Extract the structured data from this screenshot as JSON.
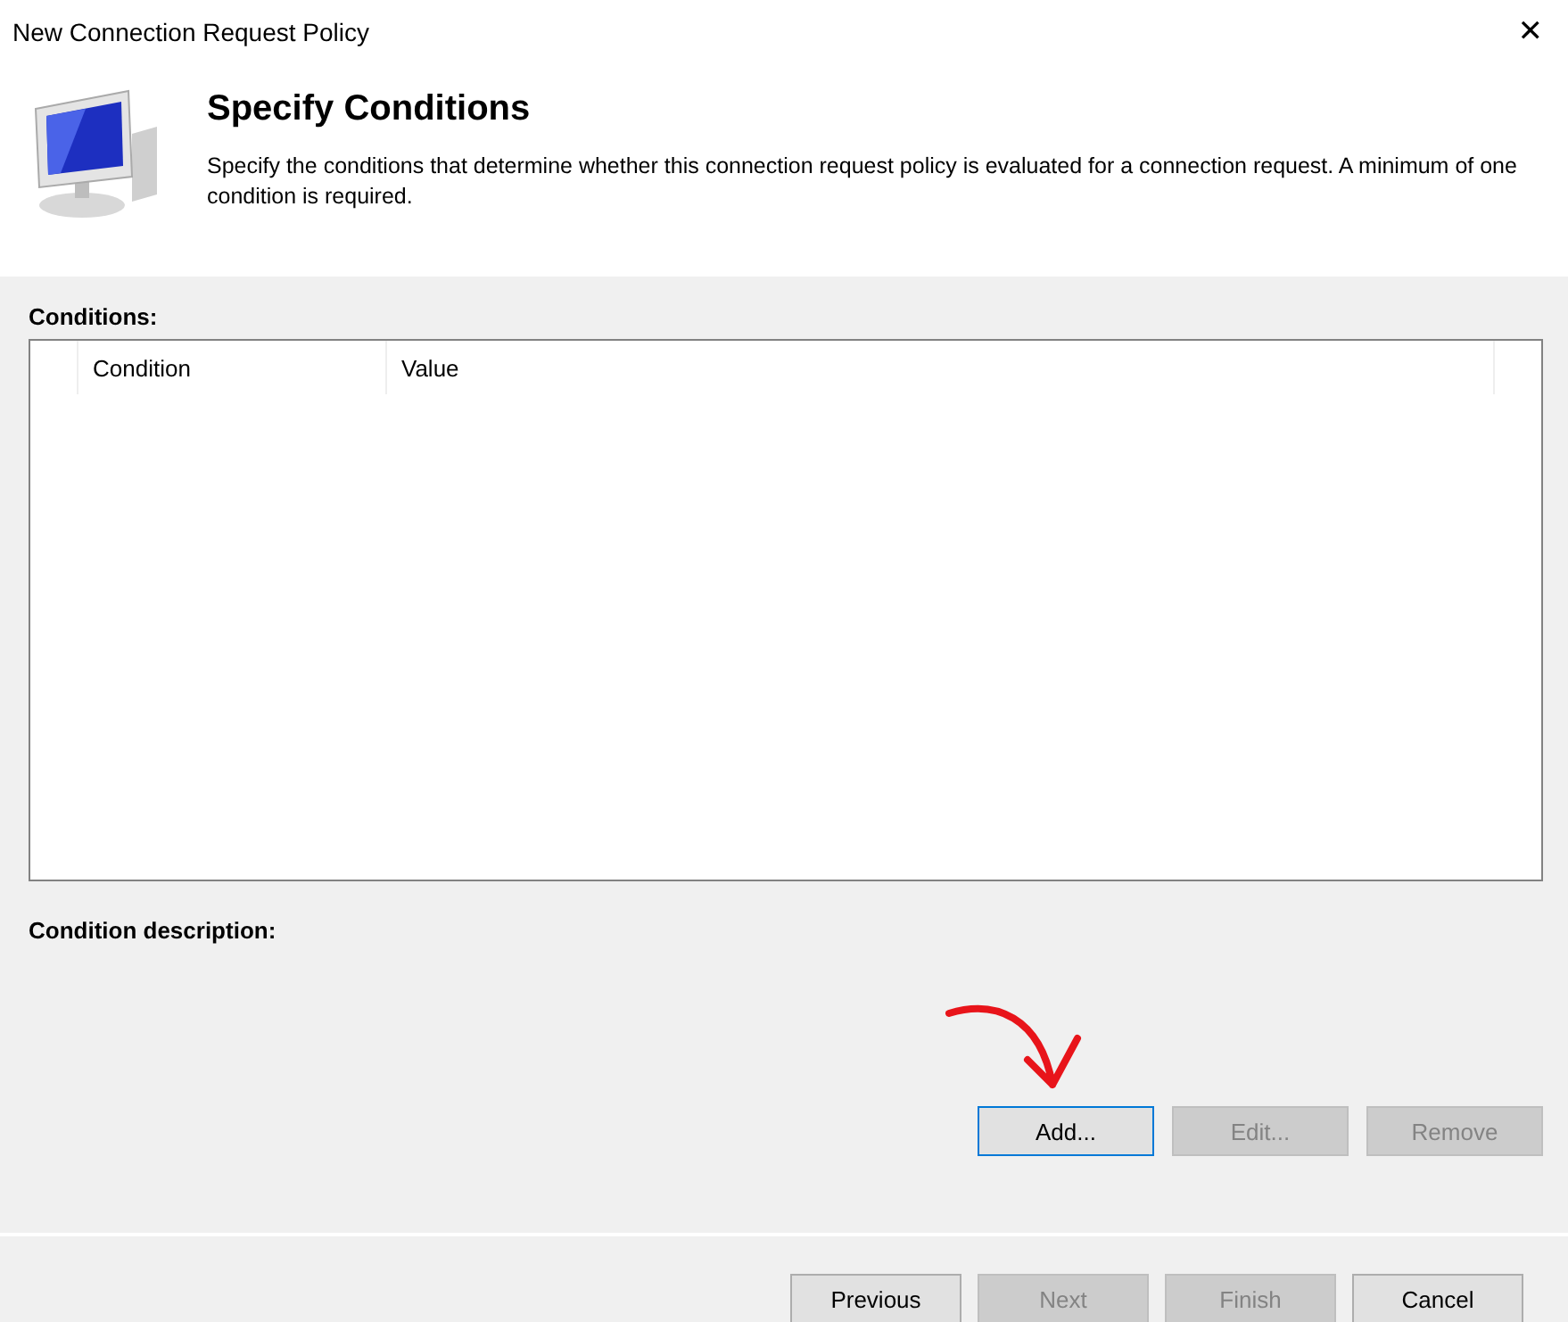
{
  "window": {
    "title": "New Connection Request Policy",
    "close": "✕"
  },
  "header": {
    "title": "Specify Conditions",
    "description": "Specify the conditions that determine whether this connection request policy is evaluated for a connection request. A minimum of one condition is required."
  },
  "conditions": {
    "label": "Conditions:",
    "columns": [
      "Condition",
      "Value"
    ]
  },
  "condition_description": {
    "label": "Condition description:"
  },
  "condition_buttons": [
    {
      "label": "Add...",
      "disabled": false,
      "focused": true
    },
    {
      "label": "Edit...",
      "disabled": true,
      "focused": false
    },
    {
      "label": "Remove",
      "disabled": true,
      "focused": false
    }
  ],
  "wizard_buttons": [
    {
      "label": "Previous",
      "disabled": false
    },
    {
      "label": "Next",
      "disabled": true
    },
    {
      "label": "Finish",
      "disabled": true
    },
    {
      "label": "Cancel",
      "disabled": false
    }
  ]
}
